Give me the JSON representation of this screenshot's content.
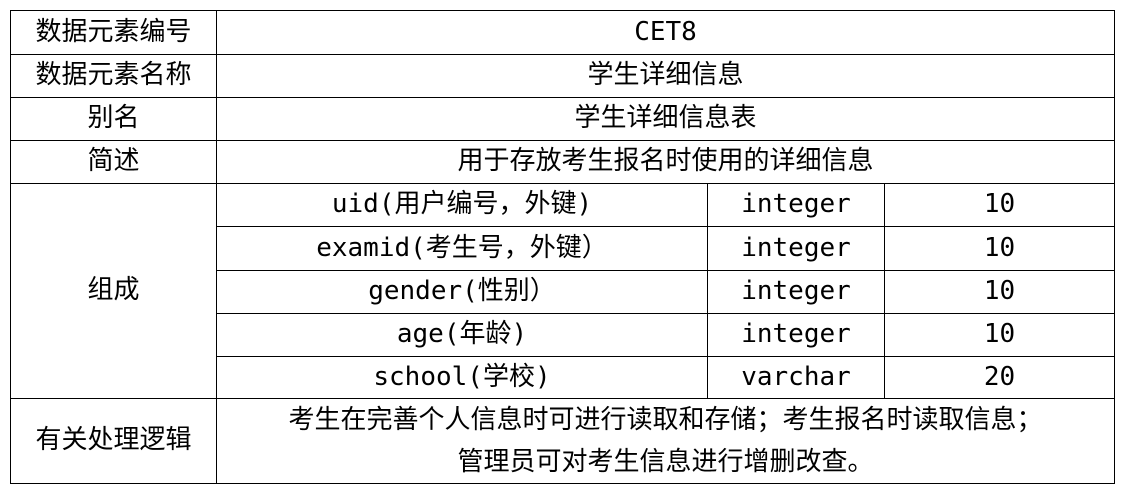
{
  "table": {
    "rows": [
      {
        "label": "数据元素编号",
        "value": "CET8"
      },
      {
        "label": "数据元素名称",
        "value": "学生详细信息"
      },
      {
        "label": "别名",
        "value": "学生详细信息表"
      },
      {
        "label": "简述",
        "value": "用于存放考生报名时使用的详细信息"
      }
    ],
    "composition": {
      "label": "组成",
      "fields": [
        {
          "name": "uid(用户编号，外键)",
          "type": "integer",
          "length": "10"
        },
        {
          "name": "examid(考生号，外键）",
          "type": "integer",
          "length": "10"
        },
        {
          "name": "gender(性别）",
          "type": "integer",
          "length": "10"
        },
        {
          "name": "age(年龄)",
          "type": "integer",
          "length": "10"
        },
        {
          "name": "school(学校)",
          "type": "varchar",
          "length": "20"
        }
      ]
    },
    "logic": {
      "label": "有关处理逻辑",
      "lines": [
        "考生在完善个人信息时可进行读取和存储；考生报名时读取信息；",
        "管理员可对考生信息进行增删改查。"
      ]
    }
  }
}
